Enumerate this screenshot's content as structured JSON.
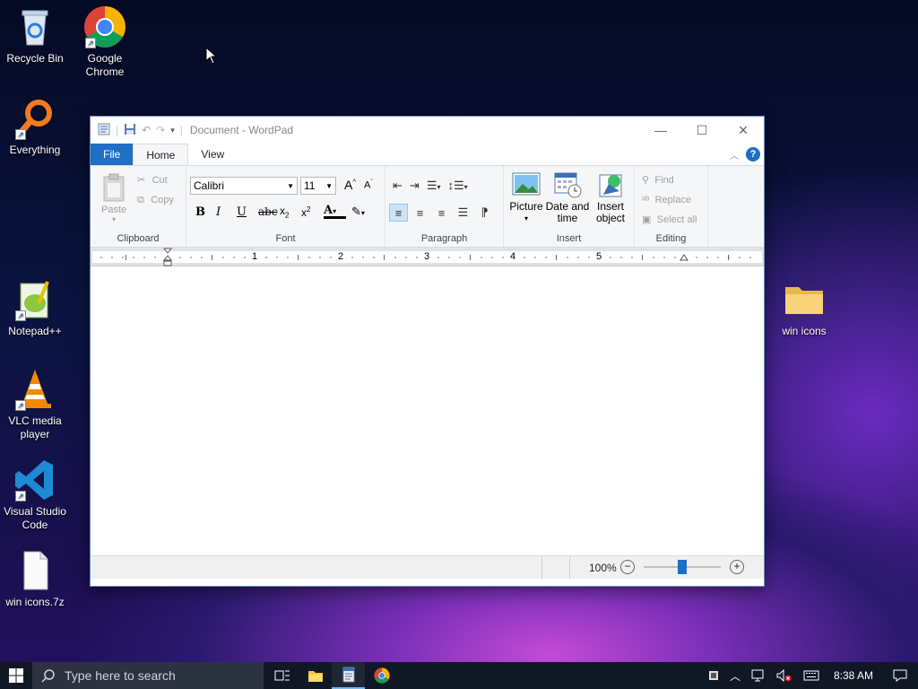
{
  "desktop": {
    "icons": [
      {
        "label": "Recycle Bin"
      },
      {
        "label": "Google Chrome"
      },
      {
        "label": "Everything"
      },
      {
        "label": "Notepad++"
      },
      {
        "label": "VLC media player"
      },
      {
        "label": "Visual Studio Code"
      },
      {
        "label": "win icons.7z"
      },
      {
        "label": "win icons"
      }
    ]
  },
  "window": {
    "title": "Document - WordPad",
    "tabs": {
      "file": "File",
      "home": "Home",
      "view": "View"
    },
    "clipboard": {
      "paste": "Paste",
      "cut": "Cut",
      "copy": "Copy",
      "label": "Clipboard"
    },
    "font": {
      "family": "Calibri",
      "size": "11",
      "label": "Font"
    },
    "paragraph": {
      "label": "Paragraph"
    },
    "insert": {
      "picture": "Picture",
      "date_time": "Date and time",
      "insert_object": "Insert object",
      "label": "Insert"
    },
    "editing": {
      "find": "Find",
      "replace": "Replace",
      "select_all": "Select all",
      "label": "Editing"
    },
    "ruler": {
      "marks": [
        "1",
        "2",
        "3",
        "4",
        "5"
      ]
    },
    "status": {
      "zoom": "100%",
      "zoom_level": 1.0
    }
  },
  "taskbar": {
    "search_placeholder": "Type here to search",
    "time": "8:38 AM"
  },
  "colors": {
    "file_tab": "#1e6fc5",
    "accent": "#1e6fc5",
    "taskbar": "#101826"
  }
}
